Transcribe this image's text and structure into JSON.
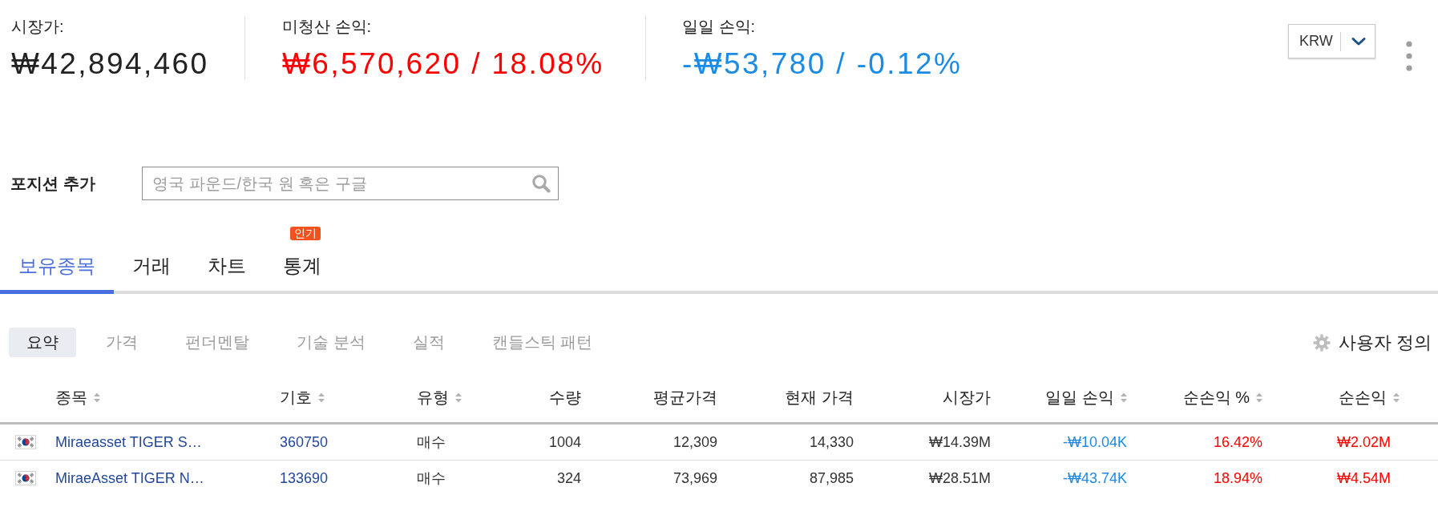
{
  "summary": [
    {
      "label": "시장가:",
      "value": "₩42,894,460",
      "color": "#222222"
    },
    {
      "label": "미청산 손익:",
      "value": "₩6,570,620 / 18.08%",
      "color": "#ff0000"
    },
    {
      "label": "일일 손익:",
      "value": "-₩53,780 / -0.12%",
      "color": "#1b8ce6"
    }
  ],
  "currency_select": {
    "value": "KRW"
  },
  "add_position": {
    "label": "포지션 추가",
    "placeholder": "영국 파운드/한국 원 혹은 구글"
  },
  "tabs": [
    {
      "label": "보유종목",
      "selected": true
    },
    {
      "label": "거래",
      "selected": false
    },
    {
      "label": "차트",
      "selected": false
    },
    {
      "label": "통계",
      "selected": false,
      "badge": "인기"
    }
  ],
  "view_tabs": [
    {
      "label": "요약",
      "selected": true
    },
    {
      "label": "가격",
      "selected": false
    },
    {
      "label": "펀더멘탈",
      "selected": false
    },
    {
      "label": "기술 분석",
      "selected": false
    },
    {
      "label": "실적",
      "selected": false
    },
    {
      "label": "캔들스틱 패턴",
      "selected": false
    }
  ],
  "customize": {
    "label": "사용자 정의"
  },
  "table": {
    "columns": [
      {
        "label": "종목",
        "sortable": true
      },
      {
        "label": "기호",
        "sortable": true
      },
      {
        "label": "유형",
        "sortable": true
      },
      {
        "label": "수량",
        "sortable": false
      },
      {
        "label": "평균가격",
        "sortable": false
      },
      {
        "label": "현재 가격",
        "sortable": false
      },
      {
        "label": "시장가",
        "sortable": false
      },
      {
        "label": "일일 손익",
        "sortable": true
      },
      {
        "label": "순손익 %",
        "sortable": true
      },
      {
        "label": "순손익",
        "sortable": true
      }
    ],
    "rows": [
      {
        "cells": [
          {
            "text": "Miraeasset TIGER S…",
            "kind": "link"
          },
          {
            "text": "360750",
            "kind": "link"
          },
          {
            "text": "매수",
            "kind": "text"
          },
          {
            "text": "1004",
            "kind": "text"
          },
          {
            "text": "12,309",
            "kind": "text"
          },
          {
            "text": "14,330",
            "kind": "text"
          },
          {
            "text": "₩14.39M",
            "kind": "text"
          },
          {
            "text": "-₩10.04K",
            "kind": "text",
            "color": "#1e88e5"
          },
          {
            "text": "16.42%",
            "kind": "text",
            "color": "#ff0000"
          },
          {
            "text": "₩2.02M",
            "kind": "text",
            "color": "#ff0000"
          }
        ]
      },
      {
        "cells": [
          {
            "text": "MiraeAsset TIGER N…",
            "kind": "link"
          },
          {
            "text": "133690",
            "kind": "link"
          },
          {
            "text": "매수",
            "kind": "text"
          },
          {
            "text": "324",
            "kind": "text"
          },
          {
            "text": "73,969",
            "kind": "text"
          },
          {
            "text": "87,985",
            "kind": "text"
          },
          {
            "text": "₩28.51M",
            "kind": "text"
          },
          {
            "text": "-₩43.74K",
            "kind": "text",
            "color": "#1e88e5"
          },
          {
            "text": "18.94%",
            "kind": "text",
            "color": "#ff0000"
          },
          {
            "text": "₩4.54M",
            "kind": "text",
            "color": "#ff0000"
          }
        ]
      }
    ]
  }
}
